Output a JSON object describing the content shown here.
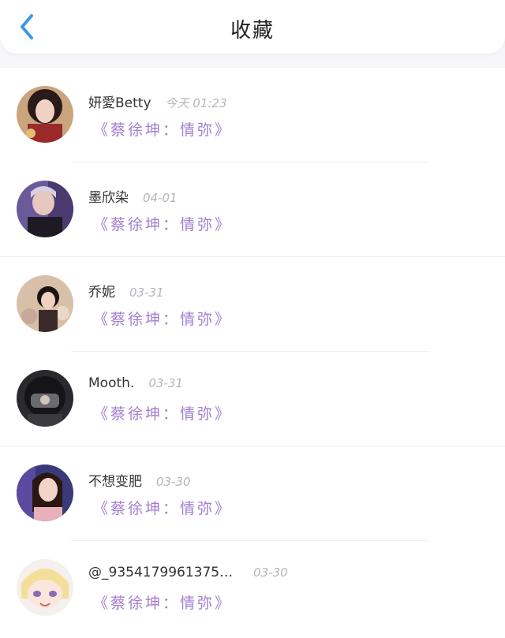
{
  "header": {
    "title": "收藏",
    "back_icon": "chevron-left-icon",
    "accent_color": "#3a9ae8"
  },
  "favorites": [
    {
      "user": "妍愛Betty",
      "time": "今天 01:23",
      "content": "《蔡徐坤：情弥》"
    },
    {
      "user": "墨欣染",
      "time": "04-01",
      "content": "《蔡徐坤：情弥》"
    },
    {
      "user": "乔妮",
      "time": "03-31",
      "content": "《蔡徐坤：情弥》"
    },
    {
      "user": "Mooth.",
      "time": "03-31",
      "content": "《蔡徐坤：情弥》"
    },
    {
      "user": "不想变肥",
      "time": "03-30",
      "content": "《蔡徐坤：情弥》"
    },
    {
      "user": "@_9354179961375…",
      "time": "03-30",
      "content": "《蔡徐坤：情弥》"
    }
  ],
  "colors": {
    "content_purple": "#a27ed0",
    "time_gray": "#b4b4bc"
  }
}
